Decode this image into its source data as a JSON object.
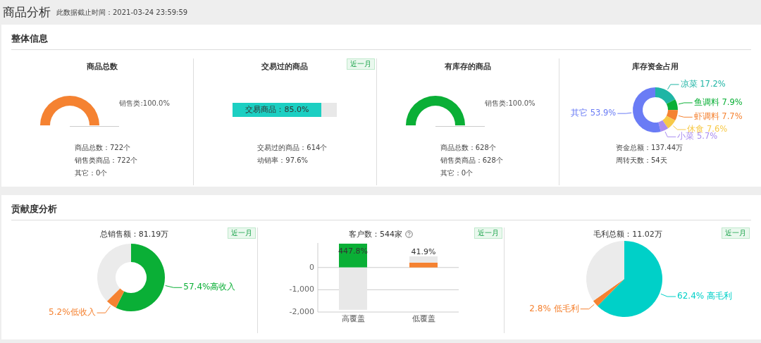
{
  "page": {
    "title": "商品分析",
    "timestamp": "此数据截止时间：2021-03-24 23:59:59"
  },
  "overview": {
    "title": "整体信息",
    "panels": [
      {
        "kind": "gauge",
        "title": "商品总数",
        "color": "#f58231",
        "level": 1,
        "reading": "销售类:100.0%",
        "stats": [
          "商品总数：722个",
          "销售类商品：722个",
          "其它：0个"
        ]
      },
      {
        "kind": "progress",
        "title": "交易过的商品",
        "badge": "近一月",
        "level": 0.85,
        "reading": "交易商品：85.0%",
        "stats": [
          "交易过的商品：614个",
          "动销率：97.6%"
        ]
      },
      {
        "kind": "gauge",
        "title": "有库存的商品",
        "color": "#0aaf36",
        "level": 1,
        "reading": "销售类:100.0%",
        "stats": [
          "商品总数：628个",
          "销售类商品：628个",
          "其它：0个"
        ]
      },
      {
        "kind": "chart",
        "title": "库存资金占用",
        "chart_data": {
          "type": "donut",
          "values": [
            17.2,
            7.9,
            7.7,
            7.6,
            5.7,
            53.9
          ],
          "colors": [
            "#1fb5a5",
            "#0aaf36",
            "#f58231",
            "#f7c948",
            "#a98cf0",
            "#6a7cf5"
          ],
          "value_labels": [
            "凉菜 17.2%",
            "鱼调料 7.9%",
            "虾调料 7.7%",
            "休食 7.6%",
            "小菜 5.7%",
            "其它 53.9%"
          ]
        },
        "stats": [
          "资金总额：137.44万",
          "周转天数：54天"
        ]
      }
    ]
  },
  "contribution": {
    "title": "贡献度分析",
    "panels": [
      {
        "kind": "chart",
        "title": "总销售额：81.19万",
        "badge": "近一月",
        "chart_data": {
          "type": "donut",
          "values": [
            57.4,
            5.2,
            37.4
          ],
          "colors": [
            "#0aaf36",
            "#f58231",
            "#ebebeb"
          ],
          "value_labels": [
            "57.4%高收入",
            "5.2%低收入",
            null
          ]
        }
      },
      {
        "kind": "chart",
        "title": "客户数：544家",
        "help": true,
        "badge": "近一月",
        "chart_data": {
          "type": "bar",
          "stacked": true,
          "categories": [
            "高覆盖",
            "低覆盖"
          ],
          "series": [
            {
              "color": "#0aaf36",
              "values": [
                1070,
                null
              ]
            },
            {
              "color": "#f58231",
              "values": [
                null,
                220
              ]
            },
            {
              "color": "#e8e8e8",
              "values": [
                -1900,
                280
              ]
            }
          ],
          "ylim": [
            -2000,
            1100
          ],
          "yticks": [
            {
              "value": 0,
              "label": "0"
            },
            {
              "value": -1000,
              "label": "-1,000"
            },
            {
              "value": -2000,
              "label": "-2,000"
            }
          ],
          "value_labels": [
            "447.8%",
            "41.9%"
          ]
        }
      },
      {
        "kind": "chart",
        "title": "毛利总额：11.02万",
        "badge": "近一月",
        "chart_data": {
          "type": "pie",
          "values": [
            62.4,
            2.8,
            34.8
          ],
          "colors": [
            "#00d0c8",
            "#f58231",
            "#ebebeb"
          ],
          "value_labels": [
            "62.4% 高毛利",
            "2.8% 低毛利",
            null
          ]
        }
      }
    ]
  }
}
